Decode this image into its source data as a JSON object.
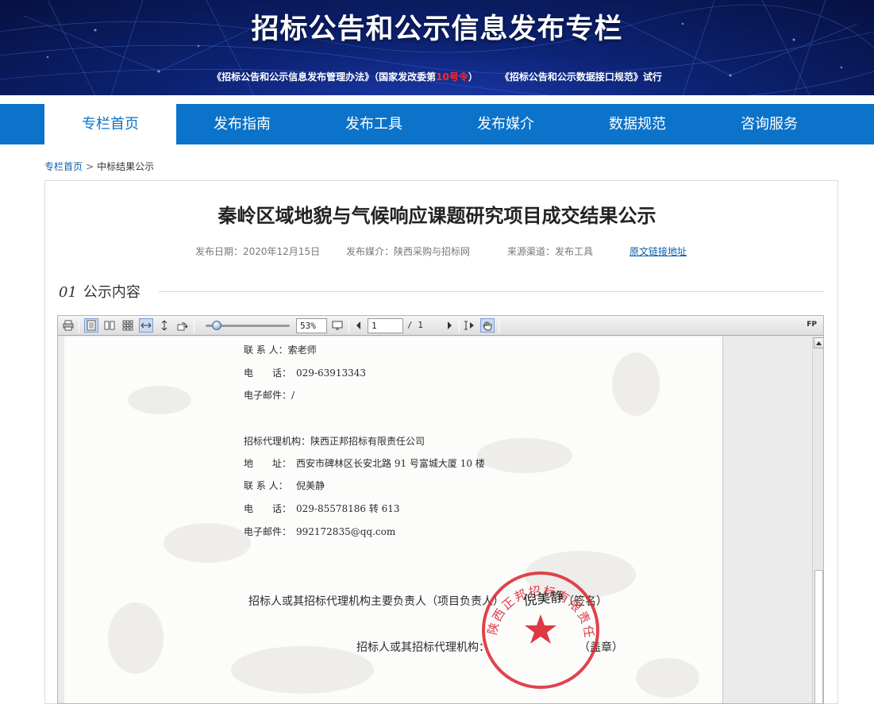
{
  "banner": {
    "title": "招标公告和公示信息发布专栏",
    "notice_prefix": "《招标公告和公示信息发布管理办法》（国家发改委第",
    "notice_highlight": "10号令",
    "notice_suffix": "）",
    "notice2": "《招标公告和公示数据接口规范》试行"
  },
  "nav": [
    "专栏首页",
    "发布指南",
    "发布工具",
    "发布媒介",
    "数据规范",
    "咨询服务"
  ],
  "breadcrumb": {
    "home": "专栏首页",
    "current": "中标结果公示"
  },
  "article": {
    "title": "秦岭区域地貌与气候响应课题研究项目成交结果公示",
    "date": "发布日期：2020年12月15日",
    "media": "发布媒介：陕西采购与招标网",
    "channel": "来源渠道：发布工具",
    "link": "原文链接地址"
  },
  "section": {
    "num": "01",
    "title": "公示内容"
  },
  "viewer": {
    "zoom": "53%",
    "zoom_level": 0.08,
    "page_current": "1",
    "page_total": "/ 1",
    "badge": "FP"
  },
  "doc": {
    "contact1_label": "联 系 人：",
    "contact1": "索老师",
    "phone1_label": "电　　话：",
    "phone1": "029-63913343",
    "email1_label": "电子邮件：",
    "email1": "/",
    "agency_label": "招标代理机构：",
    "agency": "陕西正邦招标有限责任公司",
    "addr_label": "地　　址：",
    "addr": "西安市碑林区长安北路 91 号富城大厦 10 楼",
    "contact2_label": "联 系 人：",
    "contact2": "倪美静",
    "phone2_label": "电　　话：",
    "phone2": "029-85578186 转 613",
    "email2_label": "电子邮件：",
    "email2": "992172835@qq.com",
    "sign_line": "招标人或其招标代理机构主要负责人（项目负责人）",
    "sign_tail": "（签名）",
    "seal_line": "招标人或其招标代理机构：",
    "seal_tail": "（盖章）",
    "signature": "倪美静",
    "seal_text": "陕西正邦招标有限责任公司"
  },
  "colors": {
    "nav": "#0b73c9",
    "seal": "#d9232d",
    "highlight": "#ff2a2a"
  }
}
